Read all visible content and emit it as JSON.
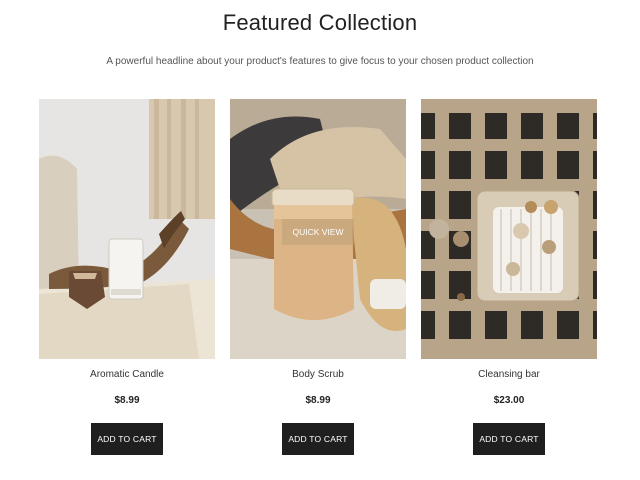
{
  "header": {
    "title": "Featured Collection",
    "subtitle": "A powerful headline about your product's features to give focus to your chosen product collection"
  },
  "products": [
    {
      "name": "Aromatic Candle",
      "price": "$8.99",
      "button": "ADD TO CART"
    },
    {
      "name": "Body Scrub",
      "price": "$8.99",
      "button": "ADD TO CART",
      "overlay": "QUICK VIEW"
    },
    {
      "name": "Cleansing bar",
      "price": "$23.00",
      "button": "ADD TO CART"
    }
  ]
}
